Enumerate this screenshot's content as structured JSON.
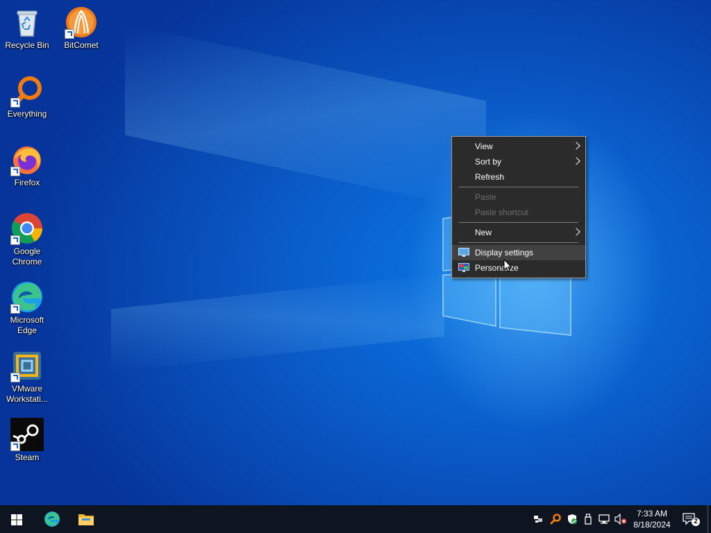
{
  "desktop": {
    "icons": [
      {
        "label": "Recycle Bin",
        "icon": "recycle-bin-icon"
      },
      {
        "label": "BitComet",
        "icon": "bitcomet-icon"
      },
      {
        "label": "Everything",
        "icon": "everything-search-icon"
      },
      {
        "label": "Firefox",
        "icon": "firefox-icon"
      },
      {
        "label": "Google Chrome",
        "icon": "chrome-icon"
      },
      {
        "label": "Microsoft Edge",
        "icon": "edge-icon"
      },
      {
        "label": "VMware Workstati...",
        "icon": "vmware-icon"
      },
      {
        "label": "Steam",
        "icon": "steam-icon"
      }
    ]
  },
  "context_menu": {
    "items": {
      "view": "View",
      "sort_by": "Sort by",
      "refresh": "Refresh",
      "paste": "Paste",
      "paste_shortcut": "Paste shortcut",
      "new": "New",
      "display_settings": "Display settings",
      "personalize": "Personalize"
    },
    "states": {
      "paste": "disabled",
      "paste_shortcut": "disabled",
      "display_settings": "highlighted"
    }
  },
  "taskbar": {
    "pinned": [
      "start-icon",
      "edge-icon",
      "file-explorer-icon"
    ],
    "tray_icons": [
      "network-drive-icon",
      "everything-search-icon",
      "security-shield-icon",
      "usb-device-icon",
      "network-icon",
      "volume-muted-icon"
    ],
    "clock": {
      "time": "7:33 AM",
      "date": "8/18/2024"
    },
    "notifications_count": "2"
  },
  "colors": {
    "desktop_blue": "#0a5cc9",
    "menu_bg": "#2b2b2b",
    "menu_hover": "#414141",
    "taskbar_bg": "#0e1420"
  }
}
